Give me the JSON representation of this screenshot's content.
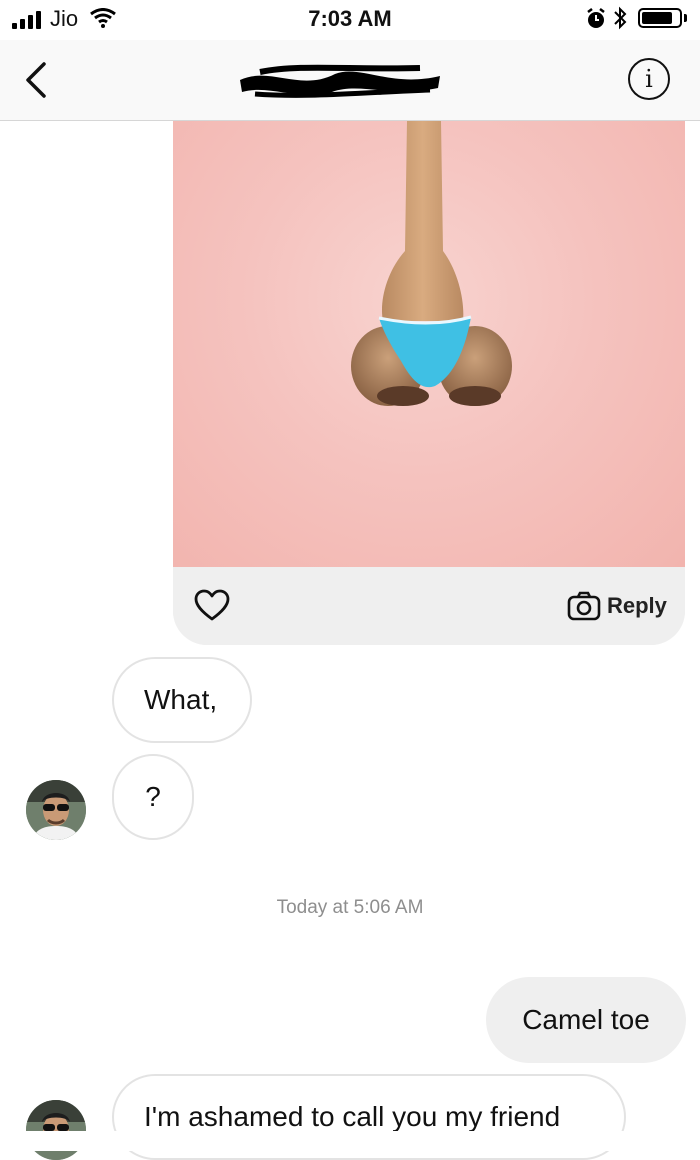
{
  "status_bar": {
    "carrier": "Jio",
    "time": "7:03 AM",
    "bluetooth_symbol": "*"
  },
  "header": {
    "title_redacted": true,
    "info_symbol": "i"
  },
  "shared_post": {
    "reply_label": "Reply"
  },
  "messages": [
    {
      "text": "What,",
      "direction": "incoming"
    },
    {
      "text": "?",
      "direction": "incoming"
    },
    {
      "text": "Camel toe",
      "direction": "outgoing"
    },
    {
      "text": "I'm ashamed to call you my friend",
      "direction": "incoming"
    }
  ],
  "timestamp": "Today at 5:06 AM",
  "colors": {
    "bubble_out": "#efefef",
    "post_background": "#f5c3bf",
    "swimsuit": "#3fc0e4"
  }
}
